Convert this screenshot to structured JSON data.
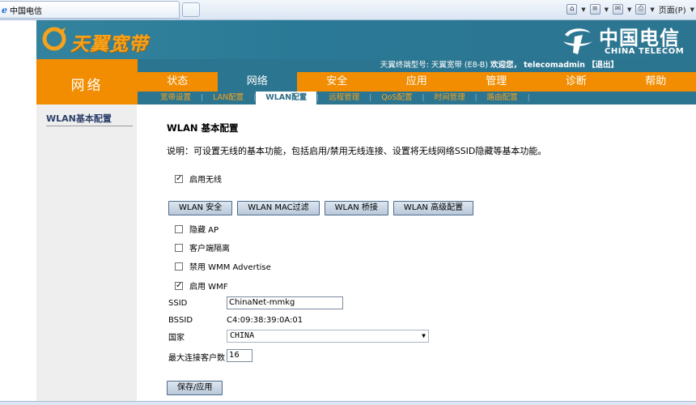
{
  "browser": {
    "tab_title": "中国电信",
    "tools": {
      "page_menu": "页面(P)"
    }
  },
  "banner": {
    "brand": "天翼宽带",
    "telecom_cn": "中国电信",
    "telecom_en": "CHINA TELECOM"
  },
  "section_title": "网络",
  "infobar": {
    "model_label": "天翼终端型号: 天翼宽带 (E8-B)",
    "welcome": "欢迎您，",
    "user": "telecomadmin",
    "logout": "【退出】"
  },
  "main_nav": [
    {
      "label": "状态",
      "active": false
    },
    {
      "label": "网络",
      "active": true
    },
    {
      "label": "安全",
      "active": false
    },
    {
      "label": "应用",
      "active": false
    },
    {
      "label": "管理",
      "active": false
    },
    {
      "label": "诊断",
      "active": false
    },
    {
      "label": "帮助",
      "active": false
    }
  ],
  "sub_nav": [
    {
      "label": "宽带设置",
      "active": false
    },
    {
      "label": "LAN配置",
      "active": false
    },
    {
      "label": "WLAN配置",
      "active": true
    },
    {
      "label": "远程管理",
      "active": false
    },
    {
      "label": "QoS配置",
      "active": false
    },
    {
      "label": "时间管理",
      "active": false
    },
    {
      "label": "路由配置",
      "active": false
    }
  ],
  "sidebar": {
    "item": "WLAN基本配置"
  },
  "main": {
    "title": "WLAN 基本配置",
    "description": "说明：可设置无线的基本功能，包括启用/禁用无线连接、设置将无线网络SSID隐藏等基本功能。",
    "enable_wireless": {
      "label": "启用无线",
      "checked": true
    },
    "buttons": {
      "security": "WLAN 安全",
      "mac_filter": "WLAN MAC过滤",
      "bridge": "WLAN 桥接",
      "advanced": "WLAN 高级配置"
    },
    "options": {
      "hide_ap": {
        "label": "隐藏 AP",
        "checked": false
      },
      "client_isolation": {
        "label": "客户端隔离",
        "checked": false
      },
      "disable_wmm": {
        "label": "禁用 WMM Advertise",
        "checked": false
      },
      "enable_wmf": {
        "label": "启用 WMF",
        "checked": true
      }
    },
    "ssid": {
      "label": "SSID",
      "value": "ChinaNet-mmkg"
    },
    "bssid": {
      "label": "BSSID",
      "value": "C4:09:38:39:0A:01"
    },
    "country": {
      "label": "国家",
      "value": "CHINA"
    },
    "max_clients": {
      "label": "最大连接客户数",
      "value": "16"
    },
    "save_button": "保存/应用"
  }
}
